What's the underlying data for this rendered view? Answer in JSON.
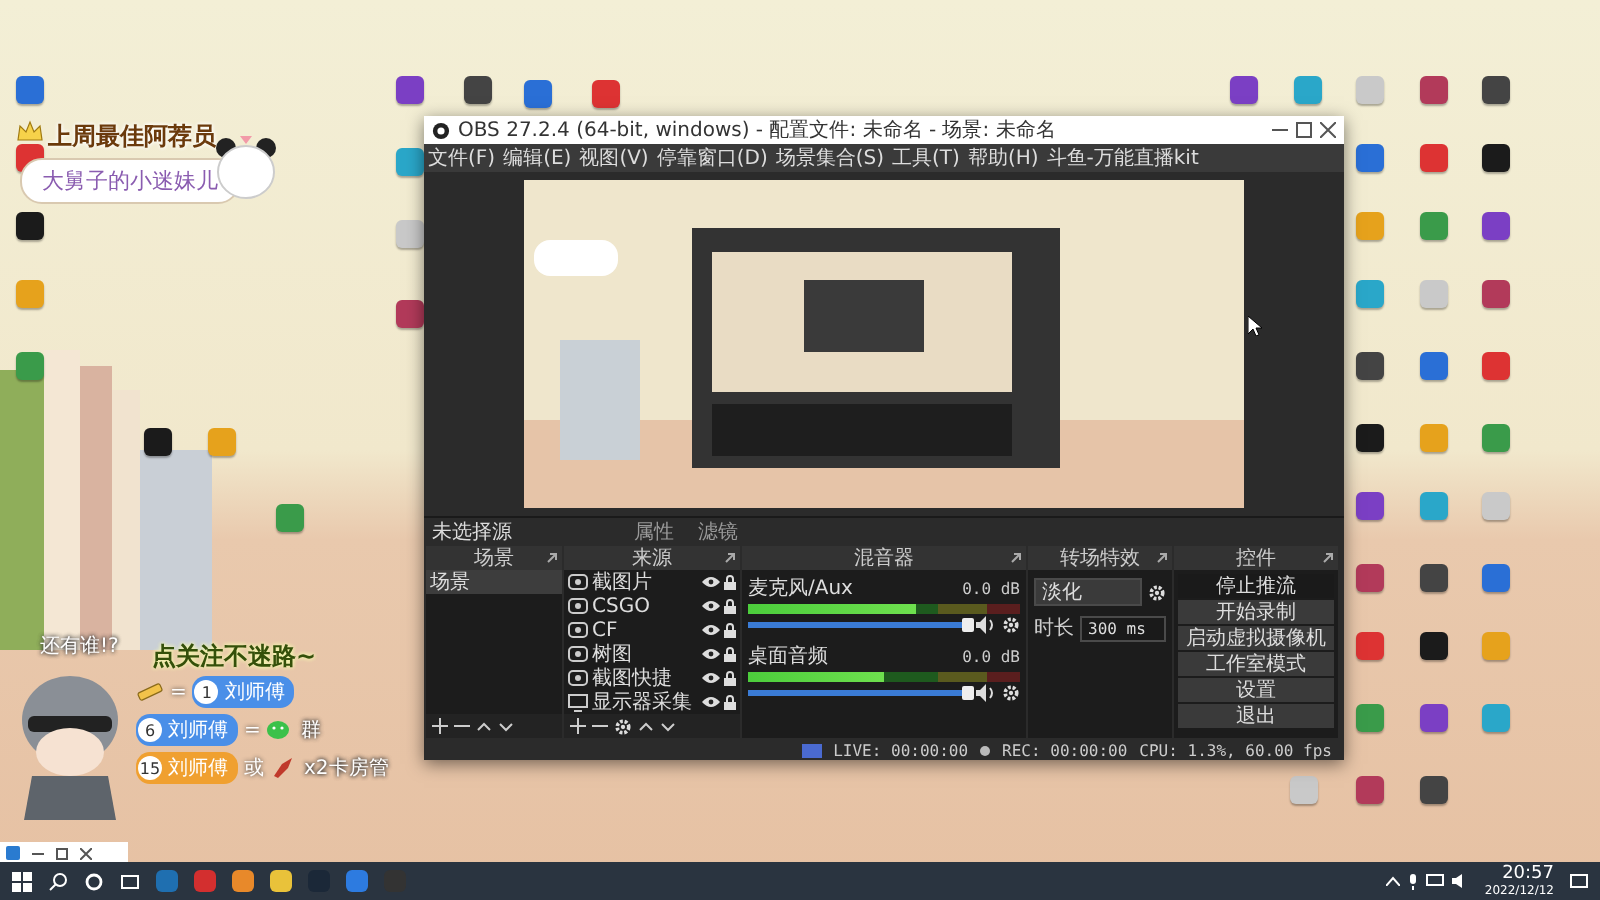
{
  "overlay": {
    "title": "上周最佳阿荐员",
    "bubble": "大舅子的小迷妹儿",
    "shout": "还有谁!?",
    "follow": "点关注不迷路~",
    "rules": [
      {
        "kind": "gift",
        "connector": "=",
        "badge": "1",
        "name": "刘师傅",
        "color": "#4a8fe8"
      },
      {
        "kind": "group",
        "connector": "=",
        "badge": "6",
        "name": "刘师傅",
        "color": "#4a8fe8",
        "text": "群"
      },
      {
        "kind": "admin",
        "connector": "或",
        "badge": "15",
        "name": "刘师傅",
        "color": "#f0a030",
        "text": "x2卡房管"
      }
    ]
  },
  "obs": {
    "title": "OBS 27.2.4 (64-bit, windows) - 配置文件: 未命名 - 场景: 未命名",
    "menu": [
      "文件(F)",
      "编辑(E)",
      "视图(V)",
      "停靠窗口(D)",
      "场景集合(S)",
      "工具(T)",
      "帮助(H)",
      "斗鱼-万能直播kit"
    ],
    "source_toolbar": {
      "status": "未选择源",
      "buttons": [
        "属性",
        "滤镜"
      ]
    },
    "scenes": {
      "title": "场景",
      "items": [
        {
          "label": "场景",
          "selected": true
        }
      ]
    },
    "sources": {
      "title": "来源",
      "items": [
        {
          "label": "截图片",
          "kind": "image"
        },
        {
          "label": "CSGO",
          "kind": "image"
        },
        {
          "label": "CF",
          "kind": "image"
        },
        {
          "label": "树图",
          "kind": "image"
        },
        {
          "label": "截图快捷",
          "kind": "image"
        },
        {
          "label": "显示器采集",
          "kind": "display"
        }
      ]
    },
    "mixer": {
      "title": "混音器",
      "channels": [
        {
          "name": "麦克风/Aux",
          "reading": "0.0 dB",
          "meter": {
            "level": 0.62
          },
          "fader": {
            "level": 1
          }
        },
        {
          "name": "桌面音频",
          "reading": "0.0 dB",
          "meter": {
            "level": 0.5
          },
          "fader": {
            "level": 1
          }
        }
      ]
    },
    "transitions": {
      "title": "转场特效",
      "type": "淡化",
      "duration_label": "时长",
      "duration": "300 ms"
    },
    "controls": {
      "title": "控件",
      "buttons": [
        {
          "label": "停止推流",
          "on": true
        },
        {
          "label": "开始录制",
          "on": false
        },
        {
          "label": "启动虚拟摄像机",
          "on": false
        },
        {
          "label": "工作室模式",
          "on": false
        },
        {
          "label": "设置",
          "on": false
        },
        {
          "label": "退出",
          "on": false
        }
      ]
    },
    "status": {
      "live": "LIVE: 00:00:00",
      "rec": "REC: 00:00:00",
      "cpu": "CPU: 1.3%, 60.00 fps"
    }
  },
  "taskbar": {
    "time": "20:57",
    "date": "2022/12/12"
  }
}
